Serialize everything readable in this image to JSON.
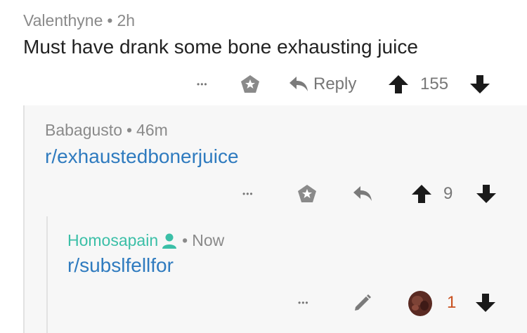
{
  "comments": [
    {
      "author": "Valenthyne",
      "time": "2h",
      "body": "Must have drank some bone exhausting juice",
      "actions": {
        "more": "•••",
        "reply_label": "Reply",
        "score": "155"
      }
    },
    {
      "author": "Babagusto",
      "time": "46m",
      "body": "r/exhaustedbonerjuice",
      "actions": {
        "more": "•••",
        "score": "9"
      }
    },
    {
      "author": "Homosapain",
      "time": "Now",
      "body": "r/subslfellfor",
      "actions": {
        "more": "•••",
        "score": "1"
      }
    }
  ],
  "separator": "•",
  "colors": {
    "link": "#2f7bbf",
    "op_author": "#3bbfa7",
    "upvoted": "#c8501e",
    "meta": "#8a8a8a",
    "thread_line": "#e2e2e2",
    "nested_bg": "#f7f7f7"
  },
  "icons": [
    "more-icon",
    "gild-icon",
    "reply-arrow-icon",
    "upvote-icon",
    "downvote-icon",
    "op-user-icon",
    "edit-pencil-icon",
    "avatar-icon"
  ]
}
